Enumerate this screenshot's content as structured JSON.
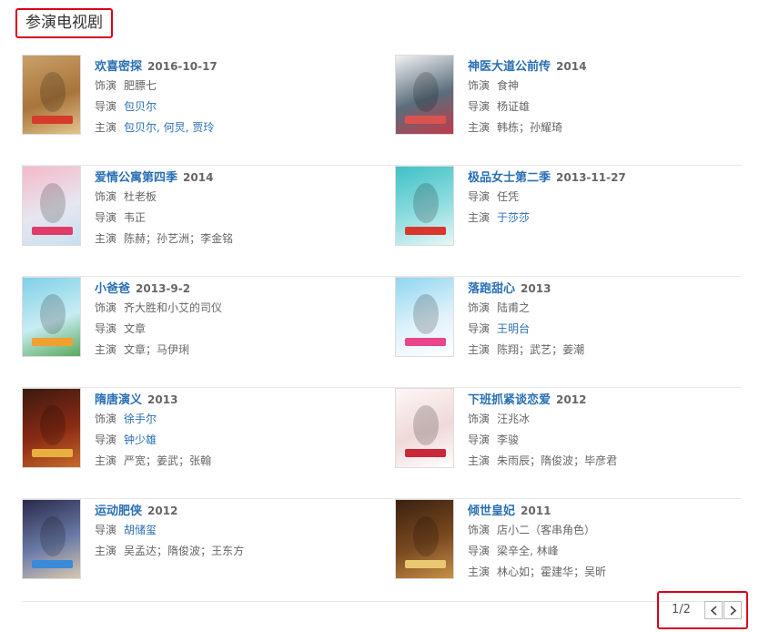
{
  "section": {
    "title": "参演电视剧"
  },
  "rows": [
    {
      "left": {
        "title": "欢喜密探",
        "date": "2016-10-17",
        "lines": [
          {
            "label": "饰演",
            "items": [
              {
                "text": "肥膘七",
                "link": false
              }
            ]
          },
          {
            "label": "导演",
            "items": [
              {
                "text": "包贝尔",
                "link": true
              }
            ]
          },
          {
            "label": "主演",
            "items": [
              {
                "text": "包贝尔",
                "link": true
              },
              {
                "text": ", ",
                "link": true
              },
              {
                "text": "何炅",
                "link": true
              },
              {
                "text": ", ",
                "link": true
              },
              {
                "text": "贾玲",
                "link": true
              }
            ]
          }
        ],
        "poster": {
          "colors": [
            "#c9a06a",
            "#a8753a",
            "#e2c48f"
          ],
          "accent": "#d63a2a"
        }
      },
      "right": {
        "title": "神医大道公前传",
        "date": "2014",
        "lines": [
          {
            "label": "饰演",
            "items": [
              {
                "text": "食神",
                "link": false
              }
            ]
          },
          {
            "label": "导演",
            "items": [
              {
                "text": "杨证雄",
                "link": false
              }
            ]
          },
          {
            "label": "主演",
            "items": [
              {
                "text": "韩栋",
                "link": false
              },
              {
                "text": "；",
                "link": false
              },
              {
                "text": "孙耀琦",
                "link": false
              }
            ]
          }
        ],
        "poster": {
          "colors": [
            "#f2f2f2",
            "#5a6d7c",
            "#c23b4a"
          ],
          "accent": "#d9534f"
        }
      }
    },
    {
      "left": {
        "title": "爱情公寓第四季",
        "date": "2014",
        "lines": [
          {
            "label": "饰演",
            "items": [
              {
                "text": "杜老板",
                "link": false
              }
            ]
          },
          {
            "label": "导演",
            "items": [
              {
                "text": "韦正",
                "link": false
              }
            ]
          },
          {
            "label": "主演",
            "items": [
              {
                "text": "陈赫",
                "link": false
              },
              {
                "text": "；",
                "link": false
              },
              {
                "text": "孙艺洲",
                "link": false
              },
              {
                "text": "；",
                "link": false
              },
              {
                "text": "李金铭",
                "link": false
              }
            ]
          }
        ],
        "poster": {
          "colors": [
            "#f5b8c8",
            "#e6e6f0",
            "#c8e0f0"
          ],
          "accent": "#e03c6a"
        }
      },
      "right": {
        "title": "极品女士第二季",
        "date": "2013-11-27",
        "lines": [
          {
            "label": "导演",
            "items": [
              {
                "text": "任凭",
                "link": false
              }
            ]
          },
          {
            "label": "主演",
            "items": [
              {
                "text": "于莎莎",
                "link": true
              }
            ]
          }
        ],
        "poster": {
          "colors": [
            "#3fc1c4",
            "#8fdde0",
            "#e8f6f6"
          ],
          "accent": "#d8382c"
        }
      }
    },
    {
      "left": {
        "title": "小爸爸",
        "date": "2013-9-2",
        "lines": [
          {
            "label": "饰演",
            "items": [
              {
                "text": "齐大胜和小艾的司仪",
                "link": false
              }
            ]
          },
          {
            "label": "导演",
            "items": [
              {
                "text": "文章",
                "link": false
              }
            ]
          },
          {
            "label": "主演",
            "items": [
              {
                "text": "文章",
                "link": false
              },
              {
                "text": "；",
                "link": false
              },
              {
                "text": "马伊琍",
                "link": false
              }
            ]
          }
        ],
        "poster": {
          "colors": [
            "#7fd0e6",
            "#c8ecf4",
            "#5aa85a"
          ],
          "accent": "#f0a030"
        }
      },
      "right": {
        "title": "落跑甜心",
        "date": "2013",
        "lines": [
          {
            "label": "饰演",
            "items": [
              {
                "text": "陆甫之",
                "link": false
              }
            ]
          },
          {
            "label": "导演",
            "items": [
              {
                "text": "王明台",
                "link": true
              }
            ]
          },
          {
            "label": "主演",
            "items": [
              {
                "text": "陈翔",
                "link": false
              },
              {
                "text": "；",
                "link": false
              },
              {
                "text": "武艺",
                "link": false
              },
              {
                "text": "；",
                "link": false
              },
              {
                "text": "姜潮",
                "link": false
              }
            ]
          }
        ],
        "poster": {
          "colors": [
            "#8fd6f0",
            "#dff2fa",
            "#ffffff"
          ],
          "accent": "#e8468a"
        }
      }
    },
    {
      "left": {
        "title": "隋唐演义",
        "date": "2013",
        "lines": [
          {
            "label": "饰演",
            "items": [
              {
                "text": "徐手尔",
                "link": true
              }
            ]
          },
          {
            "label": "导演",
            "items": [
              {
                "text": "钟少雄",
                "link": true
              }
            ]
          },
          {
            "label": "主演",
            "items": [
              {
                "text": "严宽",
                "link": false
              },
              {
                "text": "；",
                "link": false
              },
              {
                "text": "姜武",
                "link": false
              },
              {
                "text": "；",
                "link": false
              },
              {
                "text": "张翰",
                "link": false
              }
            ]
          }
        ],
        "poster": {
          "colors": [
            "#3a1a10",
            "#8a2a14",
            "#c86a2a"
          ],
          "accent": "#e8b040"
        }
      },
      "right": {
        "title": "下班抓紧谈恋爱",
        "date": "2012",
        "lines": [
          {
            "label": "饰演",
            "items": [
              {
                "text": "汪兆冰",
                "link": false
              }
            ]
          },
          {
            "label": "导演",
            "items": [
              {
                "text": "李骏",
                "link": false
              }
            ]
          },
          {
            "label": "主演",
            "items": [
              {
                "text": "朱雨辰",
                "link": false
              },
              {
                "text": "；",
                "link": false
              },
              {
                "text": "隋俊波",
                "link": false
              },
              {
                "text": "；",
                "link": false
              },
              {
                "text": "毕彦君",
                "link": false
              }
            ]
          }
        ],
        "poster": {
          "colors": [
            "#fdf6f6",
            "#f0d8d8",
            "#ffffff"
          ],
          "accent": "#c8283a"
        }
      }
    },
    {
      "left": {
        "title": "运动肥侠",
        "date": "2012",
        "lines": [
          {
            "label": "导演",
            "items": [
              {
                "text": "胡储玺",
                "link": true
              }
            ]
          },
          {
            "label": "主演",
            "items": [
              {
                "text": "吴孟达",
                "link": false
              },
              {
                "text": "；",
                "link": false
              },
              {
                "text": "隋俊波",
                "link": false
              },
              {
                "text": "；",
                "link": false
              },
              {
                "text": "王东方",
                "link": false
              }
            ]
          }
        ],
        "poster": {
          "colors": [
            "#2a2a4a",
            "#6a7aa8",
            "#d8c8b0"
          ],
          "accent": "#3a8ad8"
        }
      },
      "right": {
        "title": "倾世皇妃",
        "date": "2011",
        "lines": [
          {
            "label": "饰演",
            "items": [
              {
                "text": "店小二（客串角色）",
                "link": false
              }
            ]
          },
          {
            "label": "导演",
            "items": [
              {
                "text": "梁辛全",
                "link": false
              },
              {
                "text": ", ",
                "link": false
              },
              {
                "text": "林峰",
                "link": false
              }
            ]
          },
          {
            "label": "主演",
            "items": [
              {
                "text": "林心如",
                "link": false
              },
              {
                "text": "；",
                "link": false
              },
              {
                "text": "霍建华",
                "link": false
              },
              {
                "text": "；",
                "link": false
              },
              {
                "text": "吴昕",
                "link": false
              }
            ]
          }
        ],
        "poster": {
          "colors": [
            "#3a2010",
            "#7a4a20",
            "#c89048"
          ],
          "accent": "#e8c870"
        }
      }
    }
  ],
  "pager": {
    "page": "1/2",
    "prev_icon": "chevron-left-icon",
    "next_icon": "chevron-right-icon"
  }
}
